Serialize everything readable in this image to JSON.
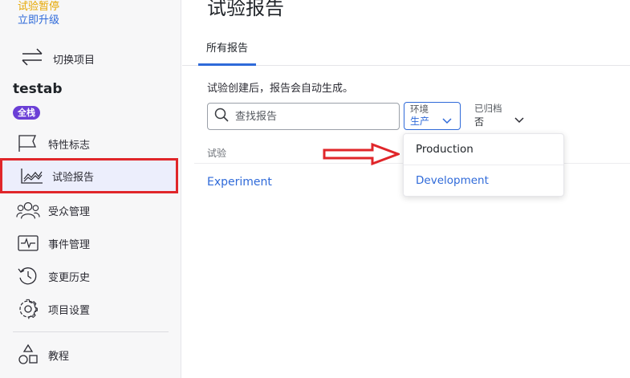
{
  "sidebar": {
    "trial_paused": "试验暂停",
    "upgrade_now": "立即升级",
    "switch_project": "切换项目",
    "project_name": "testab",
    "environment_badge": "全栈",
    "nav": {
      "feature_flags": "特性标志",
      "experiment_reports": "试验报告",
      "audiences": "受众管理",
      "events": "事件管理",
      "history": "变更历史",
      "settings": "项目设置",
      "tutorial": "教程"
    }
  },
  "main": {
    "title": "试验报告",
    "tab_all_reports": "所有报告",
    "hint": "试验创建后，报告会自动生成。",
    "search_placeholder": "查找报告",
    "environment_filter": {
      "caption": "环境",
      "value": "生产"
    },
    "archived_filter": {
      "caption": "已归档",
      "value": "否"
    },
    "column_experiment": "试验",
    "rows": [
      "Experiment"
    ]
  },
  "dropdown": {
    "options": [
      "Production",
      "Development"
    ]
  },
  "colors": {
    "accent": "#2f6ad9",
    "highlight_red": "#e0262a",
    "badge_purple": "#6b3fd6",
    "warning": "#e6a700"
  }
}
